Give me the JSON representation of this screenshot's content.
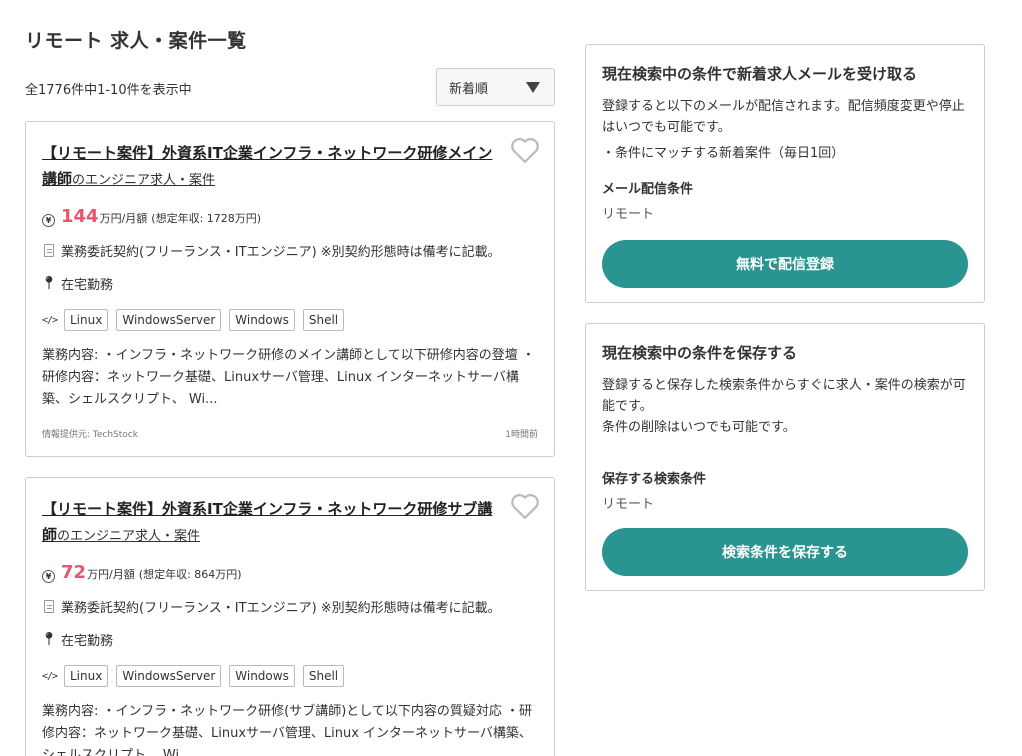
{
  "page": {
    "title": "リモート 求人・案件一覧",
    "result_count": "全1776件中1-10件を表示中",
    "sort_label": "新着順"
  },
  "jobs": [
    {
      "title": "【リモート案件】外資系IT企業インフラ・ネットワーク研修メイン講師",
      "title_suffix": "のエンジニア求人・案件",
      "salary_num": "144",
      "salary_unit": "万円/月額",
      "salary_annual": "(想定年収: 1728万円)",
      "contract": "業務委託契約(フリーランス・ITエンジニア) ※別契約形態時は備考に記載。",
      "location": "在宅勤務",
      "tags": [
        "Linux",
        "WindowsServer",
        "Windows",
        "Shell"
      ],
      "description": "業務内容: ・インフラ・ネットワーク研修のメイン講師として以下研修内容の登壇 ・研修内容：ネットワーク基礎、Linuxサーバ管理、Linux インターネットサーバ構築、シェルスクリプト、 Wi...",
      "source": "情報提供元: TechStock",
      "posted": "1時間前"
    },
    {
      "title": "【リモート案件】外資系IT企業インフラ・ネットワーク研修サブ講師",
      "title_suffix": "のエンジニア求人・案件",
      "salary_num": "72",
      "salary_unit": "万円/月額",
      "salary_annual": "(想定年収: 864万円)",
      "contract": "業務委託契約(フリーランス・ITエンジニア) ※別契約形態時は備考に記載。",
      "location": "在宅勤務",
      "tags": [
        "Linux",
        "WindowsServer",
        "Windows",
        "Shell"
      ],
      "description": "業務内容: ・インフラ・ネットワーク研修(サブ講師)として以下内容の質疑対応 ・研修内容：ネットワーク基礎、Linuxサーバ管理、Linux インターネットサーバ構築、シェルスクリプト、 Wi...",
      "source": "",
      "posted": ""
    }
  ],
  "mail_panel": {
    "title": "現在検索中の条件で新着求人メールを受け取る",
    "desc": "登録すると以下のメールが配信されます。配信頻度変更や停止はいつでも可能です。",
    "bullet": "・条件にマッチする新着案件（毎日1回）",
    "condition_label": "メール配信条件",
    "condition_value": "リモート",
    "button": "無料で配信登録"
  },
  "save_panel": {
    "title": "現在検索中の条件を保存する",
    "desc": "登録すると保存した検索条件からすぐに求人・案件の検索が可能です。",
    "desc2": "条件の削除はいつでも可能です。",
    "condition_label": "保存する検索条件",
    "condition_value": "リモート",
    "button": "検索条件を保存する"
  },
  "colors": {
    "accent": "#2a9490",
    "salary": "#e8566d"
  }
}
